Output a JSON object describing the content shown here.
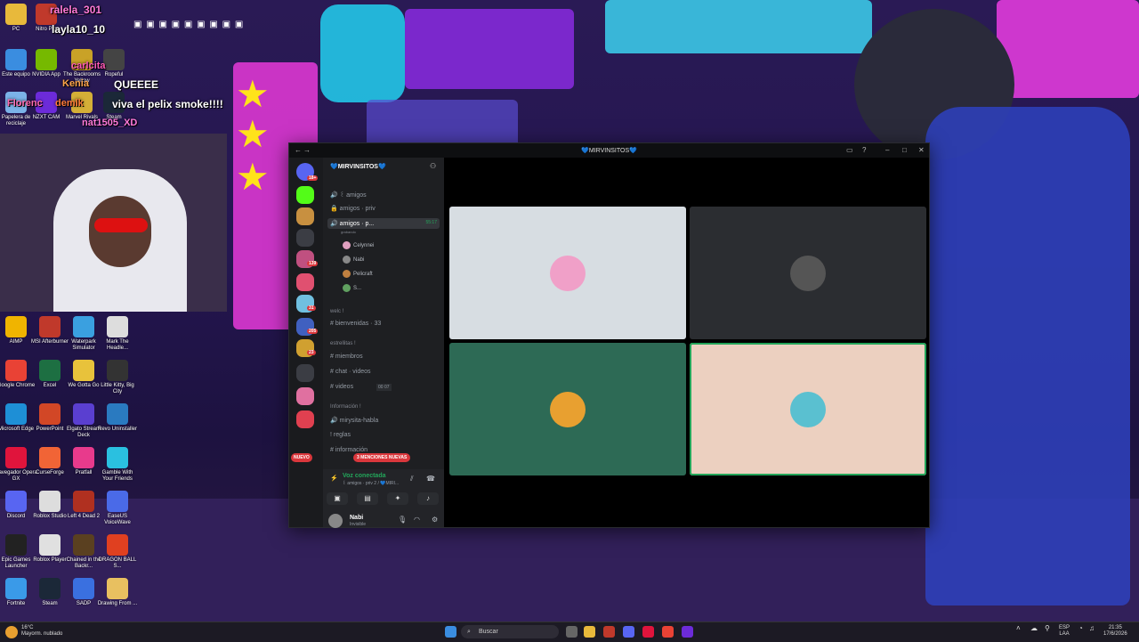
{
  "chat_overlay": {
    "lines": [
      {
        "text": "ralela_301"
      },
      {
        "text": "layla10_10"
      },
      {
        "text": "carlcita"
      },
      {
        "text": "Kenia"
      },
      {
        "text": "QUEEEE"
      },
      {
        "text": "Florenc"
      },
      {
        "text": "demlk"
      },
      {
        "text": "viva el pelix smoke!!!!"
      },
      {
        "text": "nat1505_XD"
      }
    ]
  },
  "desktop_icons": [
    {
      "label": "PC",
      "color": "#e8b93b"
    },
    {
      "label": "Nitro Pro",
      "color": "#c0392b"
    },
    {
      "label": "Este equipo",
      "color": "#3a8de0"
    },
    {
      "label": "NVIDIA App",
      "color": "#76b900"
    },
    {
      "label": "The Backrooms Yellow",
      "color": "#c9a227"
    },
    {
      "label": "Ropeful",
      "color": "#444"
    },
    {
      "label": "Papelera de reciclaje",
      "color": "#7bb3e8"
    },
    {
      "label": "NZXT CAM",
      "color": "#6c2bd9"
    },
    {
      "label": "Marvel Rivals",
      "color": "#d4af37"
    },
    {
      "label": "Steam",
      "color": "#1b2838"
    },
    {
      "label": "AIMP",
      "color": "#f0b400"
    },
    {
      "label": "MSI Afterburner",
      "color": "#c0392b"
    },
    {
      "label": "Waterpark Simulator",
      "color": "#3aa0e0"
    },
    {
      "label": "Mark The Headle...",
      "color": "#ddd"
    },
    {
      "label": "Google Chrome",
      "color": "#e94235"
    },
    {
      "label": "Excel",
      "color": "#1d6f42"
    },
    {
      "label": "We Gotta Go",
      "color": "#e8c23b"
    },
    {
      "label": "Little Kitty, Big City",
      "color": "#333"
    },
    {
      "label": "Microsoft Edge",
      "color": "#1e8fd6"
    },
    {
      "label": "PowerPoint",
      "color": "#d24726"
    },
    {
      "label": "Elgato Stream Deck",
      "color": "#5a3fd0"
    },
    {
      "label": "Revo Uninstaller",
      "color": "#2a7ac0"
    },
    {
      "label": "Navegador Opera GX",
      "color": "#e0143c"
    },
    {
      "label": "CurseForge",
      "color": "#f16436"
    },
    {
      "label": "Pratfall",
      "color": "#e83a8c"
    },
    {
      "label": "Gamble With Your Friends",
      "color": "#2ac0e0"
    },
    {
      "label": "Discord",
      "color": "#5865f2"
    },
    {
      "label": "Roblox Studio",
      "color": "#ddd"
    },
    {
      "label": "Left 4 Dead 2",
      "color": "#b03020"
    },
    {
      "label": "EaseUS VoiceWave",
      "color": "#4a6ae8"
    },
    {
      "label": "Epic Games Launcher",
      "color": "#222"
    },
    {
      "label": "Roblox Player",
      "color": "#e0e0e0"
    },
    {
      "label": "Chained in the Backr...",
      "color": "#5a4020"
    },
    {
      "label": "DRAGON BALL S...",
      "color": "#e04020"
    },
    {
      "label": "Fortnite",
      "color": "#3a9ae8"
    },
    {
      "label": "Steam",
      "color": "#1b2838"
    },
    {
      "label": "SADP",
      "color": "#3a70e0"
    },
    {
      "label": "Drawing From ...",
      "color": "#e8c060"
    }
  ],
  "discord": {
    "window_title": "💙MIRVINSITOS💙",
    "server_name": "💙MIRVINSITOS💙",
    "server_badges": [
      {
        "text": "18+",
        "color": "#da373c"
      },
      {
        "text": "139",
        "color": "#da373c"
      },
      {
        "text": "31",
        "color": "#da373c"
      },
      {
        "text": "205",
        "color": "#da373c"
      },
      {
        "text": "23",
        "color": "#da373c"
      }
    ],
    "channels_top": [
      {
        "icon": "🔊",
        "name": "꒰ amigos"
      },
      {
        "icon": "🔒",
        "name": "amigos · priv"
      },
      {
        "icon": "🔊",
        "name": "amigos · p...",
        "time": "55:17",
        "active": true
      }
    ],
    "stream_label": "grabando",
    "voice_members": [
      {
        "name": "Celynnei",
        "color": "#e0a0c0"
      },
      {
        "name": "Nabi",
        "color": "#888"
      },
      {
        "name": "Pelicraft",
        "color": "#c08040"
      },
      {
        "name": "S...",
        "color": "#60a060"
      }
    ],
    "categories": [
      {
        "name": "welc !",
        "channels": [
          {
            "icon": "#",
            "name": "bienvenidas",
            "extra": "33"
          }
        ]
      },
      {
        "name": "estrellitas !",
        "channels": [
          {
            "icon": "#",
            "name": "miembros"
          },
          {
            "icon": "#",
            "name": "chat · videos"
          },
          {
            "icon": "#",
            "name": "videos",
            "extra": "00 07"
          }
        ]
      },
      {
        "name": "Información !",
        "channels": [
          {
            "icon": "🔊",
            "name": "mirysita-habla"
          },
          {
            "icon": "!",
            "name": "reglas"
          },
          {
            "icon": "#",
            "name": "información"
          }
        ]
      }
    ],
    "nuevo_label": "NUEVO",
    "mentions_label": "3 MENCIONES NUEVAS",
    "voice_status": "Voz conectada",
    "voice_channel": "꒰ amigos · priv 2 / 💙MIRI...",
    "user_name": "Nabi",
    "user_status": "Invisible",
    "tiles": [
      {
        "bg": "#d7dde2",
        "avatar": "#f0a0c8",
        "border": "none"
      },
      {
        "bg": "#2b2d31",
        "avatar": "#555",
        "border": "none"
      },
      {
        "bg": "#2d6a55",
        "avatar": "#e8a030",
        "border": "none"
      },
      {
        "bg": "#ecd0c0",
        "avatar": "#5ac0d0",
        "border": "#23a55a"
      }
    ]
  },
  "taskbar": {
    "temp": "16°C",
    "weather": "Mayorm. nublado",
    "search_placeholder": "Buscar",
    "lang": "ESP",
    "lang2": "LAA",
    "time": "21:35",
    "date": "17/6/2026"
  }
}
